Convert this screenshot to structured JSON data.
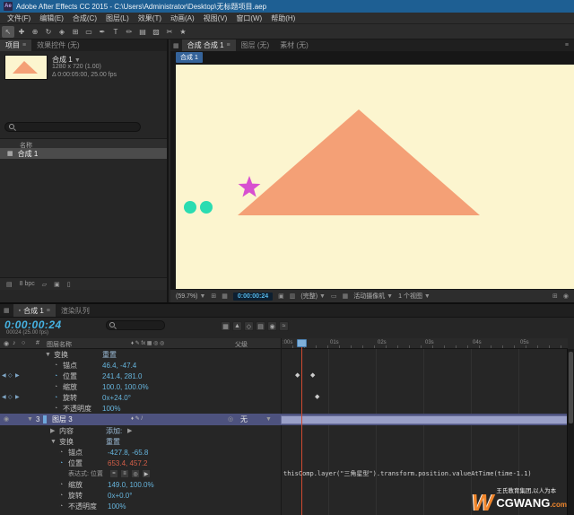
{
  "app": {
    "icon_label": "Ae",
    "title": "Adobe After Effects CC 2015 - C:\\Users\\Administrator\\Desktop\\无标题项目.aep"
  },
  "menu": {
    "items": [
      "文件(F)",
      "编辑(E)",
      "合成(C)",
      "图层(L)",
      "效果(T)",
      "动画(A)",
      "视图(V)",
      "窗口(W)",
      "帮助(H)"
    ]
  },
  "toolbar": {
    "tools": [
      {
        "name": "selection",
        "glyph": "↖"
      },
      {
        "name": "hand",
        "glyph": "✚"
      },
      {
        "name": "zoom",
        "glyph": "⊕"
      },
      {
        "name": "rotation",
        "glyph": "↻"
      },
      {
        "name": "camera",
        "glyph": "◈"
      },
      {
        "name": "pan-behind",
        "glyph": "⊞"
      },
      {
        "name": "shape",
        "glyph": "▭"
      },
      {
        "name": "pen",
        "glyph": "✒"
      },
      {
        "name": "type",
        "glyph": "T"
      },
      {
        "name": "brush",
        "glyph": "✏"
      },
      {
        "name": "clone-stamp",
        "glyph": "▤"
      },
      {
        "name": "eraser",
        "glyph": "▨"
      },
      {
        "name": "roto-brush",
        "glyph": "✂"
      },
      {
        "name": "puppet-pin",
        "glyph": "★"
      }
    ]
  },
  "project": {
    "tabs": [
      {
        "label": "项目"
      },
      {
        "label": "效果控件 (无)"
      }
    ],
    "preview": {
      "name": "合成 1",
      "dims": "1280 x 720 (1.00)",
      "timing": "Δ 0:00:05:00, 25.00 fps"
    },
    "columns": {
      "name": "名称"
    },
    "items": [
      {
        "label": "合成 1"
      }
    ],
    "footer": {
      "bit_depth": "8 bpc"
    }
  },
  "viewer": {
    "tabs": [
      {
        "label": "合成 合成 1"
      },
      {
        "label": "图层 (无)"
      },
      {
        "label": "素材 (无)"
      }
    ],
    "badge": "合成 1",
    "status": {
      "zoom": "(59.7%)",
      "timecode": "0:00:00:24",
      "resolution": "(完整)",
      "camera": "活动摄像机",
      "views": "1 个视图"
    }
  },
  "timeline": {
    "tabs": [
      {
        "label": "合成 1"
      },
      {
        "label": "渲染队列"
      }
    ],
    "timecode": "0:00:00:24",
    "frames_info": "00024 (25.00 fps)",
    "columns": {
      "hash": "#",
      "layer_name": "图层名称",
      "parent": "父级"
    },
    "ruler": [
      ":00s",
      "01s",
      "02s",
      "03s",
      "04s",
      "05s"
    ],
    "add_label": "添加:",
    "parent_value": "无",
    "rows": [
      {
        "name": "变换",
        "action": "重置"
      },
      {
        "name": "锚点",
        "value": "46.4, -47.4"
      },
      {
        "name": "位置",
        "value": "241.4, 281.0"
      },
      {
        "name": "缩放",
        "value": "100.0, 100.0%"
      },
      {
        "name": "旋转",
        "value": "0x+24.0°"
      },
      {
        "name": "不透明度",
        "value": "100%"
      },
      {
        "number": "3",
        "name": "图层 3"
      },
      {
        "name": "内容"
      },
      {
        "name": "变换",
        "action": "重置"
      },
      {
        "name": "锚点",
        "value": "-427.8, -65.8"
      },
      {
        "name": "位置",
        "value": "653.4, 457.2"
      },
      {
        "name": "表达式: 位置"
      },
      {
        "name": "缩放",
        "value": "149.0, 100.0%"
      },
      {
        "name": "旋转",
        "value": "0x+0.0°"
      },
      {
        "name": "不透明度",
        "value": "100%"
      }
    ],
    "expression": "thisComp.layer(\"三角星型\").transform.position.valueAtTime(time-1.1)"
  },
  "watermark": {
    "mark": "W",
    "cn": "王氏教育集团,以人为本",
    "brand": "CGWANG",
    "suffix": ".com"
  },
  "colors": {
    "canvas_bg": "#fcf5cf",
    "triangle": "#f4a076",
    "dot": "#2bdcb1",
    "star": "#d84fd0"
  },
  "icons": {
    "menu": "≡",
    "dropdown": "▼",
    "twirl_open": "▼",
    "twirl_closed": "▶",
    "stopwatch": "◔",
    "keyframe": "◆",
    "nav_prev": "◀",
    "nav_next": "▶",
    "add_keyframe": "◇",
    "eye": "◉",
    "audio": "♪",
    "solo": "○",
    "pickwhip": "◎",
    "comp": "▦",
    "layer_switches": "♦ ✎ /",
    "switches_header": "♦ ✎ fx ▦ ◎ ◎",
    "expr_enable": "=",
    "expr_graph": "≡",
    "expr_pickwhip": "◎",
    "expr_menu": "▶",
    "grid": "⊞",
    "mask": "▦",
    "snapshot": "▣",
    "channels": "▥",
    "roi": "▭",
    "transparency": "▦",
    "pixel_aspect": "⊞",
    "fast_preview": "◉",
    "mini_flowchart": "▦",
    "draft_3d": "▲",
    "shy": "◇",
    "frame_blend": "▤",
    "motion_blur": "◉",
    "graph_editor": "≈",
    "interpret": "▤",
    "new_folder": "▱",
    "new_comp": "▣",
    "delete": "▯",
    "panel_box": "▦",
    "tab_dot": "▪"
  }
}
